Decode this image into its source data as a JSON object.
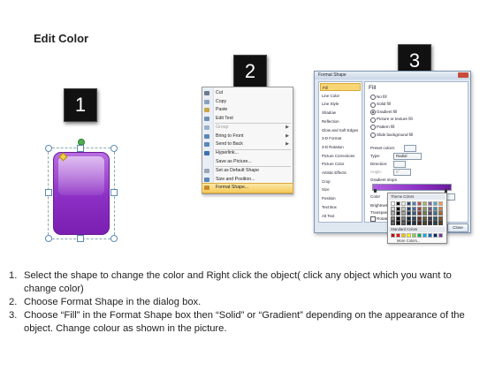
{
  "title": "Edit Color",
  "step_numbers": [
    "1",
    "2",
    "3"
  ],
  "context_menu": {
    "items": [
      {
        "label": "Cut",
        "icon": "scissors-icon",
        "color": "#6b7a8c"
      },
      {
        "label": "Copy",
        "icon": "copy-icon",
        "color": "#8aa0c0"
      },
      {
        "label": "Paste",
        "icon": "clipboard-icon",
        "color": "#c9a84a"
      },
      {
        "label": "Edit Text",
        "icon": "edit-text-icon",
        "color": "#6d8fb8"
      },
      {
        "label": "Group",
        "icon": "group-icon",
        "color": "#9ab0c8",
        "disabled": true,
        "submenu": true
      },
      {
        "label": "Bring to Front",
        "icon": "bring-front-icon",
        "color": "#5a86b8",
        "submenu": true
      },
      {
        "label": "Send to Back",
        "icon": "send-back-icon",
        "color": "#5a86b8",
        "submenu": true
      },
      {
        "label": "Hyperlink...",
        "icon": "hyperlink-icon",
        "color": "#3f6fb0"
      },
      {
        "label": "Save as Picture...",
        "icon": "",
        "color": "#ffffff"
      },
      {
        "label": "Set as Default Shape",
        "icon": "default-shape-icon",
        "color": "#9aa5b5"
      },
      {
        "label": "Size and Position...",
        "icon": "size-position-icon",
        "color": "#5a86b8"
      },
      {
        "label": "Format Shape...",
        "icon": "format-shape-icon",
        "color": "#c68a2a",
        "highlighted": true
      }
    ],
    "submenu_glyph": "▶"
  },
  "format_dialog": {
    "title": "Format Shape",
    "nav": [
      "Fill",
      "Line Color",
      "Line Style",
      "Shadow",
      "Reflection",
      "Glow and Soft Edges",
      "3-D Format",
      "3-D Rotation",
      "Picture Corrections",
      "Picture Color",
      "Artistic Effects",
      "Crop",
      "Size",
      "Position",
      "Text Box",
      "Alt Text"
    ],
    "pane_heading": "Fill",
    "fill_options": [
      "No fill",
      "Solid fill",
      "Gradient fill",
      "Picture or texture fill",
      "Pattern fill",
      "Slide background fill"
    ],
    "selected_fill": "Gradient fill",
    "preset_label": "Preset colors:",
    "type_label": "Type:",
    "type_value": "Radial",
    "direction_label": "Direction:",
    "angle_label": "Angle:",
    "angle_value": "0°",
    "stops_label": "Gradient stops",
    "color_label": "Color",
    "position_label": "Position:",
    "position_value": "0%",
    "brightness_label": "Brightness:",
    "transparency_label": "Transparency:",
    "rotate_label": "Rotate w",
    "close_label": "Close",
    "gradient_color": "#8c2fc4"
  },
  "color_popup": {
    "theme_label": "Theme Colors",
    "standard_label": "Standard Colors",
    "more_label": "More Colors...",
    "theme_row": [
      "#ffffff",
      "#000000",
      "#eeece1",
      "#1f497d",
      "#4f81bd",
      "#c0504d",
      "#9bbb59",
      "#8064a2",
      "#4bacc6",
      "#f79646"
    ],
    "standard_row": [
      "#c00000",
      "#ff0000",
      "#ffc000",
      "#ffff00",
      "#92d050",
      "#00b050",
      "#00b0f0",
      "#0070c0",
      "#002060",
      "#7030a0"
    ]
  },
  "shape": {
    "fill": "#8c2fc4"
  },
  "instructions": [
    {
      "num": "1.",
      "text": "Select the shape to change the color and Right click the object( click any object which you want to change color)"
    },
    {
      "num": "2.",
      "text": "Choose Format Shape in the dialog box."
    },
    {
      "num": "3.",
      "text": "Choose “Fill” in the Format Shape box then “Solid” or “Gradient” depending on the appearance of the object. Change colour as shown in the picture."
    }
  ]
}
